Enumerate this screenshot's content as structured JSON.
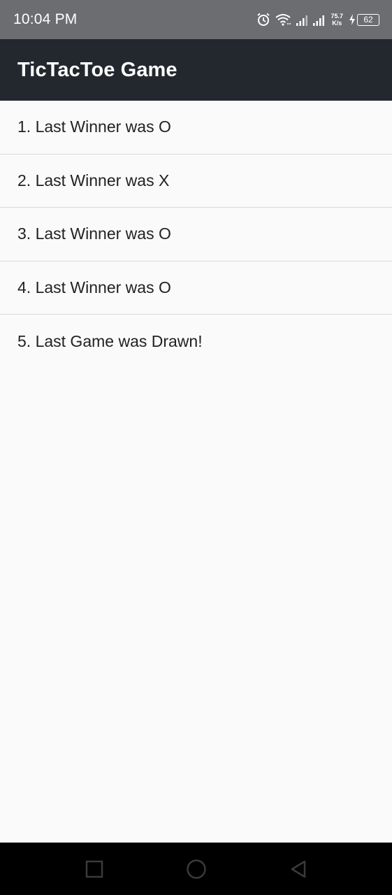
{
  "status_bar": {
    "time": "10:04 PM",
    "net_speed_value": "75.7",
    "net_speed_unit": "K/s",
    "battery": "62",
    "icons": [
      "alarm-icon",
      "wifi-icon",
      "signal-icon",
      "signal-icon",
      "charging-icon",
      "battery-icon"
    ]
  },
  "app_bar": {
    "title": "TicTacToe Game"
  },
  "history": {
    "items": [
      "1. Last Winner was O",
      "2. Last Winner was X",
      "3. Last Winner was O",
      "4. Last Winner was O",
      "5. Last Game was Drawn!"
    ]
  },
  "nav_bar": {
    "buttons": [
      "recents-icon",
      "home-icon",
      "back-icon"
    ]
  },
  "colors": {
    "status_bar": "#6b6d70",
    "app_bar": "#23282f",
    "background": "#fafafa",
    "divider": "#d9d9d9",
    "text": "#222222",
    "nav_bar": "#000000"
  }
}
